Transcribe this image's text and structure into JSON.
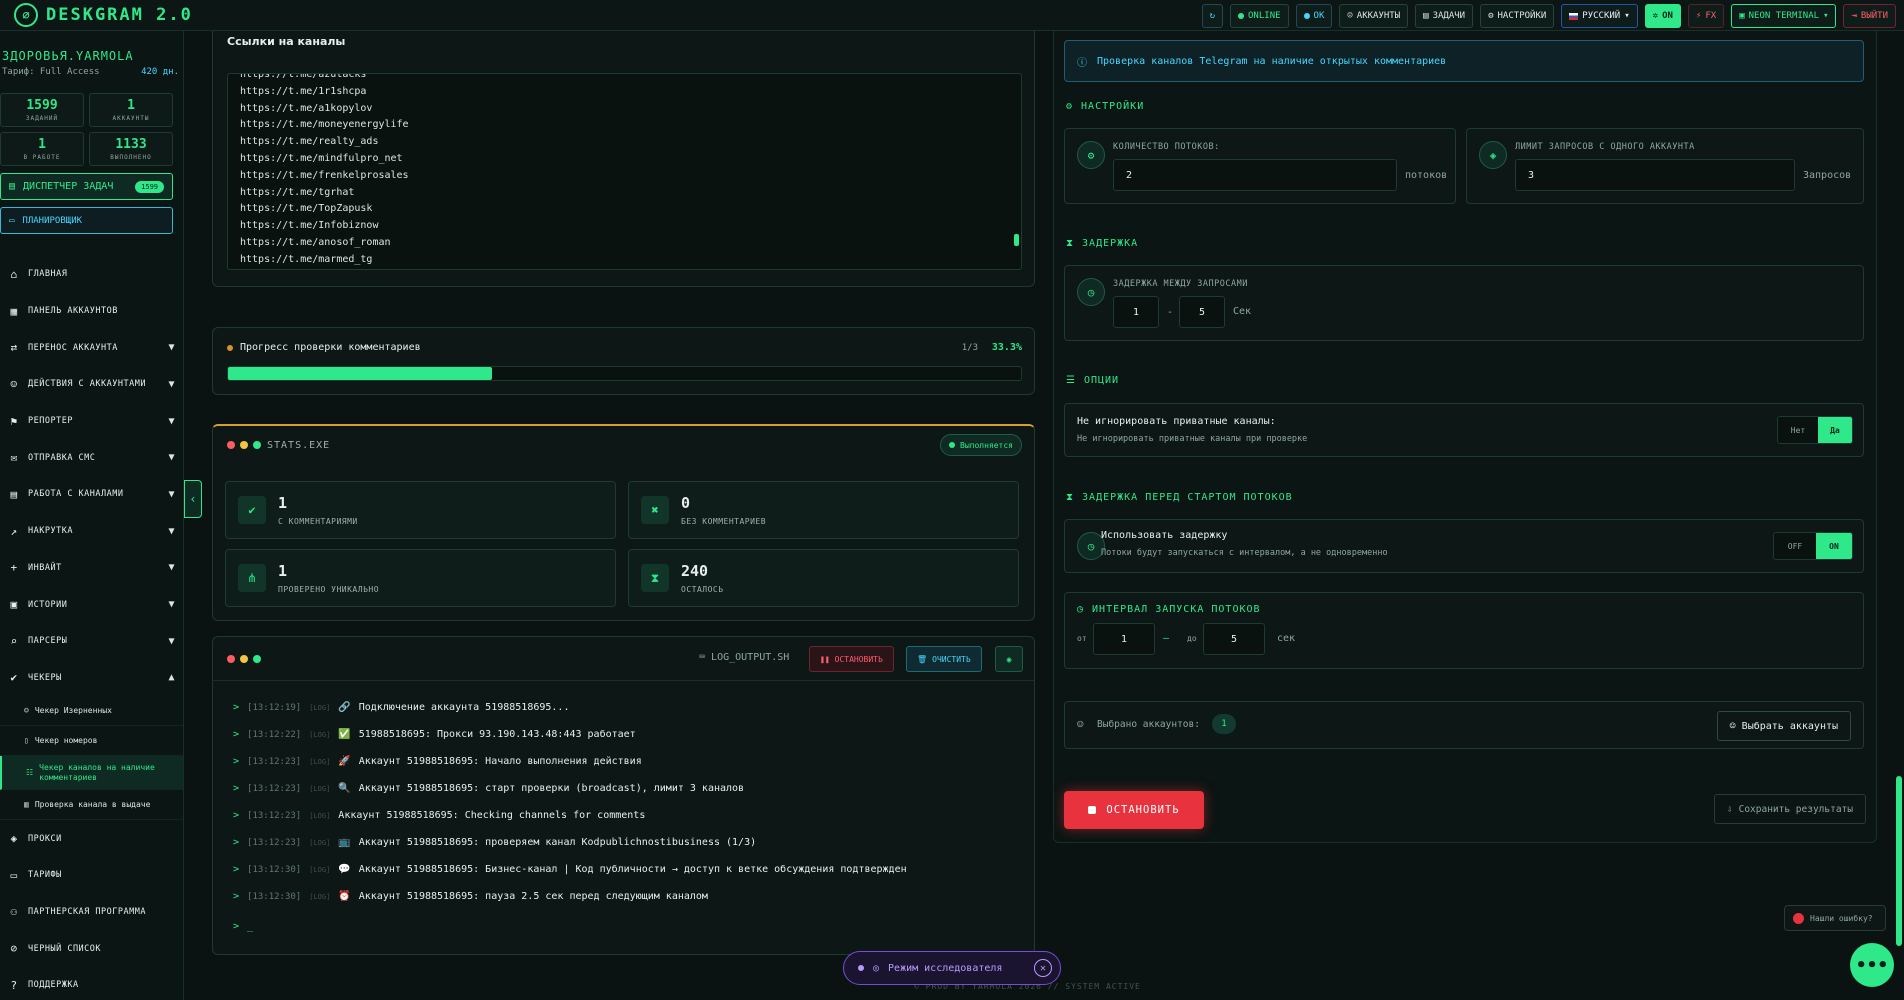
{
  "app": {
    "logo_text": "DESKGRAM 2.0"
  },
  "topbar": {
    "online": "ONLINE",
    "ok": "OK",
    "accounts": "АККАУНТЫ",
    "tasks": "ЗАДАЧИ",
    "settings": "НАСТРОЙКИ",
    "language": "РУССКИЙ",
    "on": "ON",
    "fx": "FX",
    "theme": "NEON TERMINAL",
    "exit": "ВЫЙТИ"
  },
  "sidebar": {
    "user": "ЗДОРОВЬЯ.YARMOLA",
    "tariff_label": "Тариф: Full Access",
    "tariff_days": "420 дн.",
    "stats": [
      {
        "value": "1599",
        "label": "ЗАДАНИЙ"
      },
      {
        "value": "1",
        "label": "АККАУНТЫ"
      },
      {
        "value": "1",
        "label": "В РАБОТЕ"
      },
      {
        "value": "1133",
        "label": "ВЫПОЛНЕНО"
      }
    ],
    "task_manager": "ДИСПЕТЧЕР ЗАДАЧ",
    "task_badge": "1599",
    "planner": "ПЛАНИРОВЩИК",
    "nav": [
      {
        "label": "ГЛАВНАЯ",
        "icon": "⌂"
      },
      {
        "label": "ПАНЕЛЬ АККАУНТОВ",
        "icon": "▦"
      },
      {
        "label": "ПЕРЕНОС АККАУНТА",
        "icon": "⇄"
      },
      {
        "label": "ДЕЙСТВИЯ С АККАУНТАМИ",
        "icon": "☺"
      },
      {
        "label": "РЕПОРТЕР",
        "icon": "⚑"
      },
      {
        "label": "ОТПРАВКА СМС",
        "icon": "✉"
      },
      {
        "label": "РАБОТА С КАНАЛАМИ",
        "icon": "▤"
      },
      {
        "label": "НАКРУТКА",
        "icon": "↗"
      },
      {
        "label": "ИНВАЙТ",
        "icon": "+"
      },
      {
        "label": "ИСТОРИИ",
        "icon": "▣"
      },
      {
        "label": "ПАРСЕРЫ",
        "icon": "⌕"
      },
      {
        "label": "ЧЕКЕРЫ",
        "icon": "✔"
      }
    ],
    "sub": [
      "Чекер Изерненных",
      "Чекер номеров",
      "Чекер каналов на наличие комментариев",
      "Проверка канала в выдаче"
    ],
    "nav_after": [
      {
        "label": "ПРОКСИ",
        "icon": "◈"
      },
      {
        "label": "ТАРИФЫ",
        "icon": "▭"
      },
      {
        "label": "ПАРТНЕРСКАЯ ПРОГРАММА",
        "icon": "⚇"
      },
      {
        "label": "ЧЕРНЫЙ СПИСОК",
        "icon": "⊘"
      },
      {
        "label": "ПОДДЕРЖКА",
        "icon": "?"
      }
    ]
  },
  "links": {
    "title": "Ссылки на каналы",
    "items": [
      "https://t.me/azutacks",
      "https://t.me/1r1shcpa",
      "https://t.me/a1kopylov",
      "https://t.me/moneyenergylife",
      "https://t.me/realty_ads",
      "https://t.me/mindfulpro_net",
      "https://t.me/frenkelprosales",
      "https://t.me/tgrhat",
      "https://t.me/TopZapusk",
      "https://t.me/Infobiznow",
      "https://t.me/anosof_roman",
      "https://t.me/marmed_tg"
    ]
  },
  "progress": {
    "title": "Прогресс проверки комментариев",
    "count": "1/3",
    "percent": "33.3%",
    "fraction": 0.333
  },
  "stats_panel": {
    "name": "STATS.EXE",
    "status": "Выполняется",
    "cards": [
      {
        "value": "1",
        "label": "С КОММЕНТАРИЯМИ",
        "icon": "✔"
      },
      {
        "value": "0",
        "label": "БЕЗ КОММЕНТАРИЕВ",
        "icon": "✖"
      },
      {
        "value": "1",
        "label": "ПРОВЕРЕНО УНИКАЛЬНО",
        "icon": "⋔"
      },
      {
        "value": "240",
        "label": "ОСТАЛОСЬ",
        "icon": "⧗"
      }
    ]
  },
  "log": {
    "name": "LOG_OUTPUT.SH",
    "stop": "ОСТАНОВИТЬ",
    "clear": "ОЧИСТИТЬ",
    "lines": [
      {
        "ts": "[13:12:19]",
        "tag": "[LOG]",
        "icon": "🔗",
        "text": "Подключение аккаунта 51988518695..."
      },
      {
        "ts": "[13:12:22]",
        "tag": "[LOG]",
        "icon": "✅",
        "text": "51988518695: Прокси 93.190.143.48:443 работает"
      },
      {
        "ts": "[13:12:23]",
        "tag": "[LOG]",
        "icon": "🚀",
        "text": "Аккаунт 51988518695: Начало выполнения действия"
      },
      {
        "ts": "[13:12:23]",
        "tag": "[LOG]",
        "icon": "🔍",
        "text": "Аккаунт 51988518695: старт проверки (broadcast), лимит 3 каналов"
      },
      {
        "ts": "[13:12:23]",
        "tag": "[LOG]",
        "icon": "",
        "text": "Аккаунт 51988518695: Checking channels for comments"
      },
      {
        "ts": "[13:12:23]",
        "tag": "[LOG]",
        "icon": "📺",
        "text": "Аккаунт 51988518695: проверяем канал Kodpublichnostibusiness (1/3)"
      },
      {
        "ts": "[13:12:30]",
        "tag": "[LOG]",
        "icon": "💬",
        "text": "Аккаунт 51988518695: Бизнес-канал | Код публичности → доступ к ветке обсуждения подтвержден"
      },
      {
        "ts": "[13:12:30]",
        "tag": "[LOG]",
        "icon": "⏰",
        "text": "Аккаунт 51988518695: пауза 2.5 сек перед следующим каналом"
      }
    ],
    "prompt": "_"
  },
  "right": {
    "info": "Проверка каналов Telegram на наличие открытых комментариев",
    "settings_title": "НАСТРОЙКИ",
    "threads_label": "КОЛИЧЕСТВО ПОТОКОВ:",
    "threads_value": "2",
    "threads_unit": "потоков",
    "limit_label": "ЛИМИТ ЗАПРОСОВ С ОДНОГО АККАУНТА",
    "limit_value": "3",
    "limit_unit": "Запросов",
    "delay_title": "ЗАДЕРЖКА",
    "delay_label": "ЗАДЕРЖКА МЕЖДУ ЗАПРОСАМИ",
    "delay_from": "1",
    "delay_to": "5",
    "delay_unit": "Сек",
    "options_title": "ОПЦИИ",
    "opt1_title": "Не игнорировать приватные каналы:",
    "opt1_sub": "Не игнорировать приватные каналы при проверке",
    "no": "Нет",
    "yes": "Да",
    "start_delay_title": "ЗАДЕРЖКА ПЕРЕД СТАРТОМ ПОТОКОВ",
    "use_delay_title": "Использовать задержку",
    "use_delay_sub": "Потоки будут запускаться с интервалом, а не одновременно",
    "off": "OFF",
    "on": "ON",
    "interval_title": "ИНТЕРВАЛ ЗАПУСКА ПОТОКОВ",
    "from": "от",
    "interval_from": "1",
    "to": "до",
    "interval_to": "5",
    "sec": "сек",
    "selected_accounts": "Выбрано аккаунтов:",
    "selected_count": "1",
    "choose_accounts": "Выбрать аккаунты",
    "stop": "ОСТАНОВИТЬ",
    "save": "Сохранить результаты"
  },
  "footer": "© PROD BY YARMOLA 2026   // SYSTEM ACTIVE",
  "research": "Режим исследователя",
  "bug": "Нашли ошибку?"
}
